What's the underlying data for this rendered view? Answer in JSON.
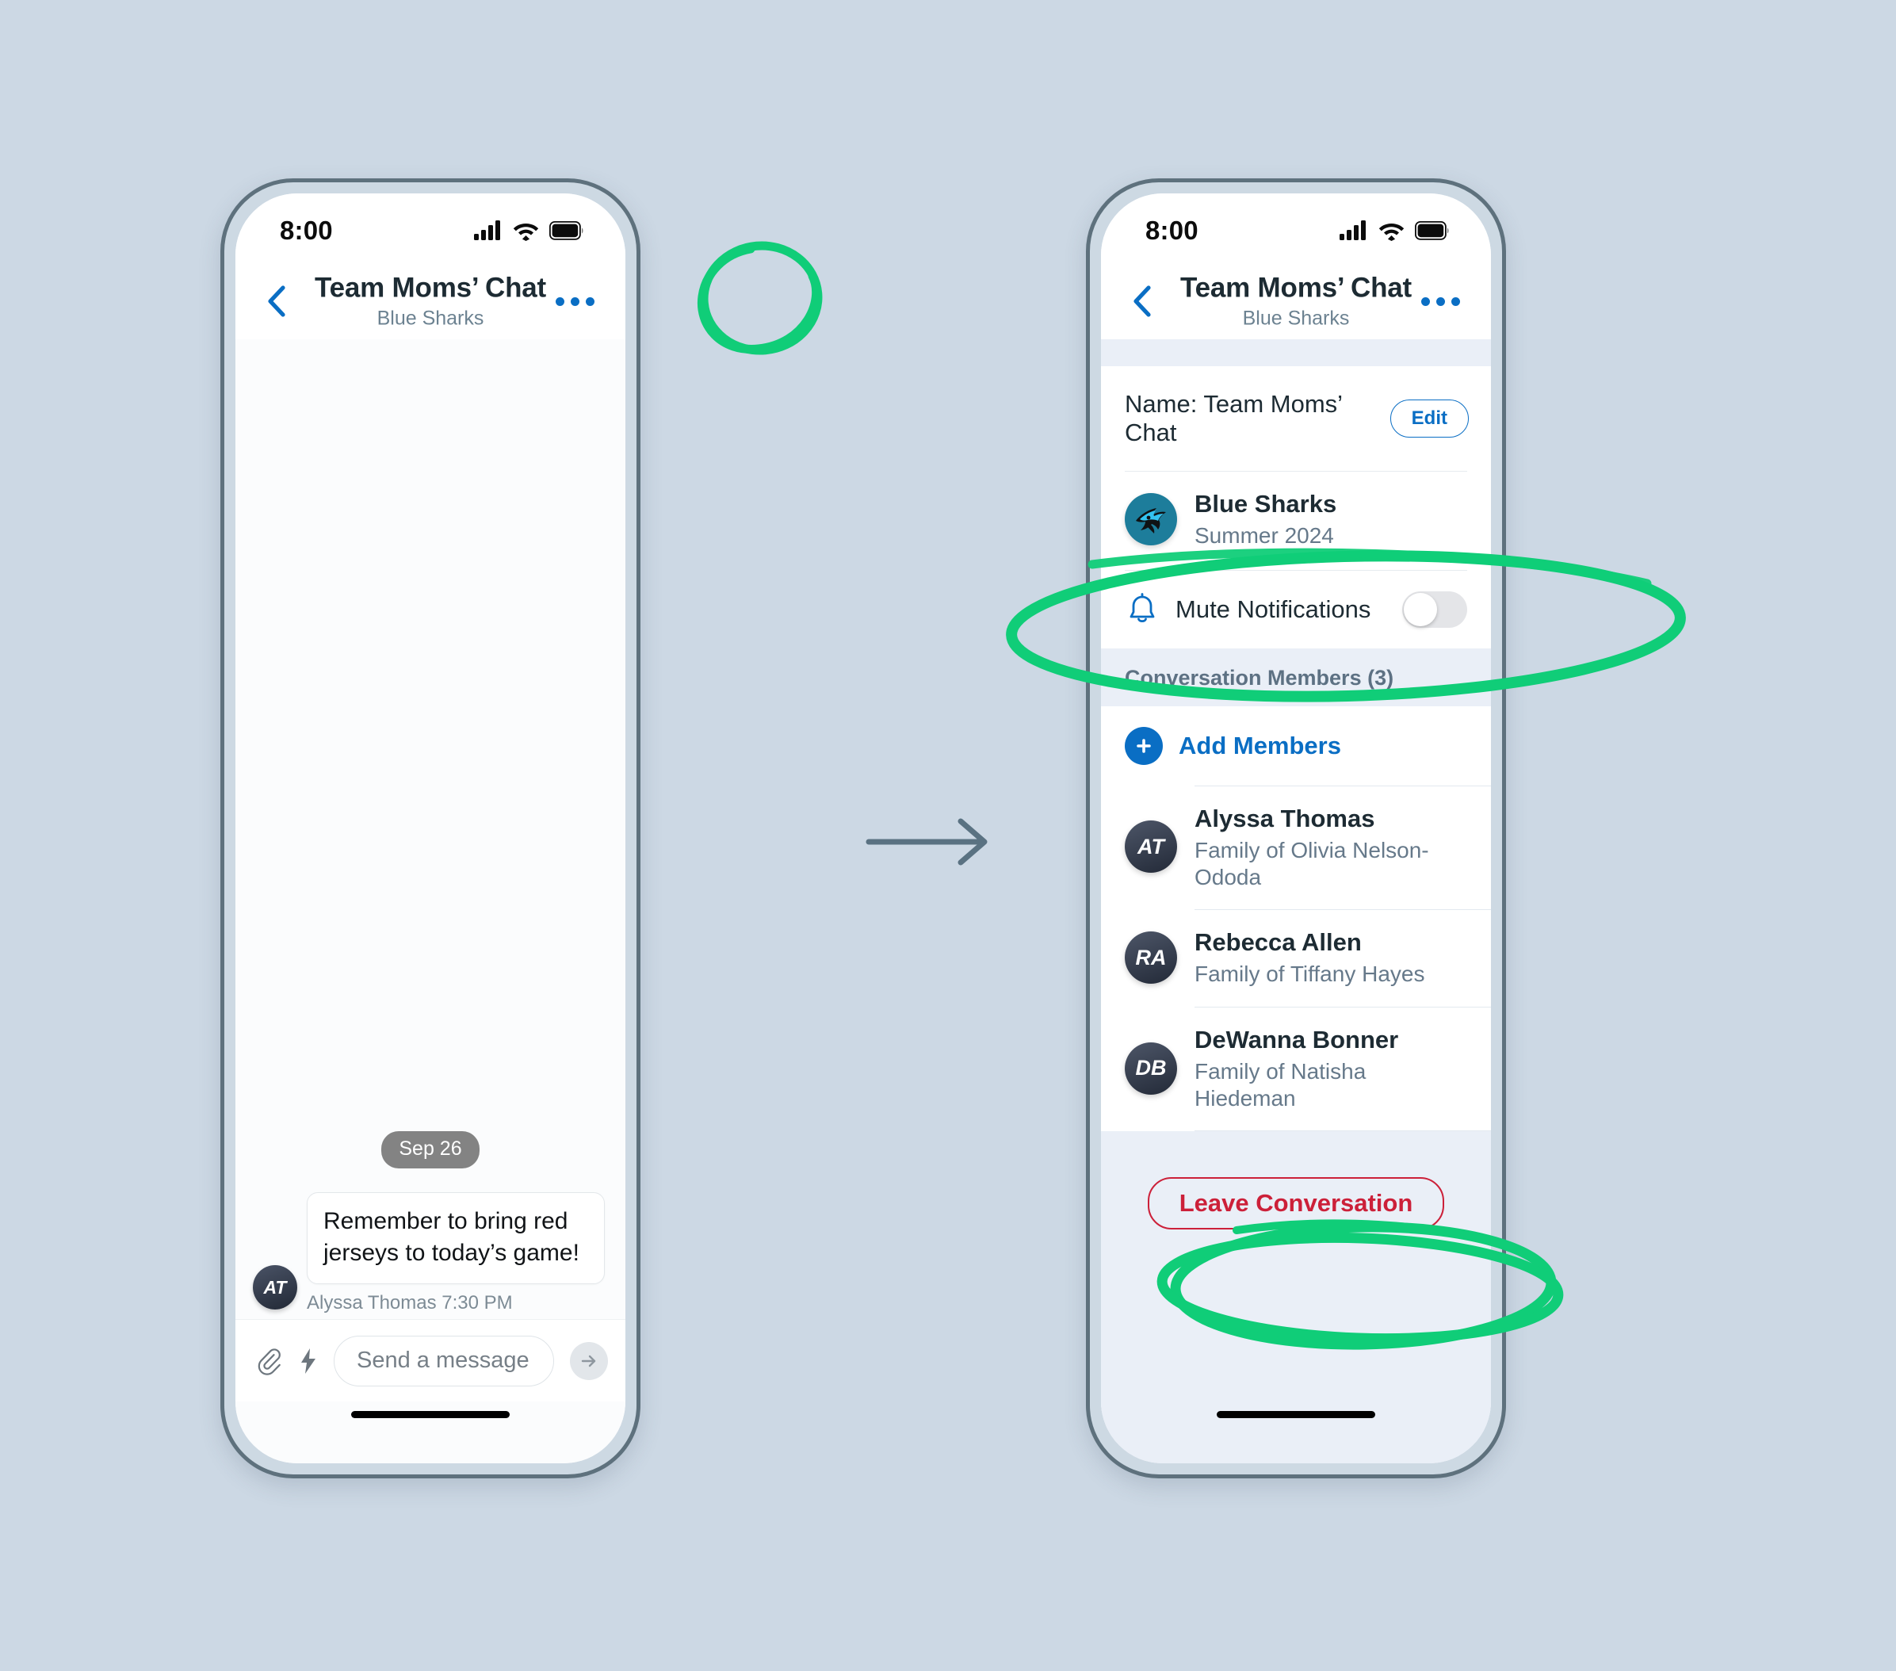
{
  "meta": {
    "background_color": "#ccd8e4",
    "accent_blue": "#0a6ec4",
    "annotation_green": "#10cd78",
    "danger_red": "#cc2039",
    "team_teal": "#1d7d9b"
  },
  "status_bar": {
    "time": "8:00",
    "icons": [
      "cellular-signal-icon",
      "wifi-icon",
      "battery-icon"
    ]
  },
  "nav_header": {
    "back_icon": "chevron-left-icon",
    "title": "Team Moms’ Chat",
    "subtitle": "Blue Sharks",
    "more_icon": "more-options-icon"
  },
  "left_phone": {
    "thread": {
      "date_divider": "Sep 26",
      "messages": [
        {
          "avatar_initials": "AT",
          "text": "Remember to bring red jerseys to today’s game!",
          "meta": "Alyssa Thomas 7:30 PM"
        }
      ]
    },
    "composer": {
      "attach_icon": "paperclip-icon",
      "quick_icon": "lightning-bolt-icon",
      "placeholder": "Send a message",
      "value": "",
      "send_icon": "send-arrow-icon"
    }
  },
  "right_phone": {
    "name_row": {
      "label": "Name: Team Moms’ Chat",
      "edit_label": "Edit"
    },
    "team": {
      "avatar_icon": "blue-sharks-logo-icon",
      "name": "Blue Sharks",
      "season": "Summer 2024"
    },
    "mute": {
      "icon": "bell-icon",
      "label": "Mute Notifications",
      "toggle_state": "off"
    },
    "members_section": {
      "header": "Conversation Members (3)",
      "add_members_label": "Add Members",
      "add_icon": "plus-circle-icon",
      "members": [
        {
          "initials": "AT",
          "name": "Alyssa Thomas",
          "relation": "Family of Olivia Nelson-Ododa"
        },
        {
          "initials": "RA",
          "name": "Rebecca Allen",
          "relation": "Family of Tiffany Hayes"
        },
        {
          "initials": "DB",
          "name": "DeWanna Bonner",
          "relation": "Family of Natisha Hiedeman"
        }
      ]
    },
    "leave_button": "Leave Conversation"
  },
  "annotations": {
    "flow_arrow_icon": "right-arrow-icon",
    "highlights": [
      "more-options-icon-circle",
      "mute-notifications-row-ellipse",
      "leave-conversation-button-ellipse"
    ]
  }
}
